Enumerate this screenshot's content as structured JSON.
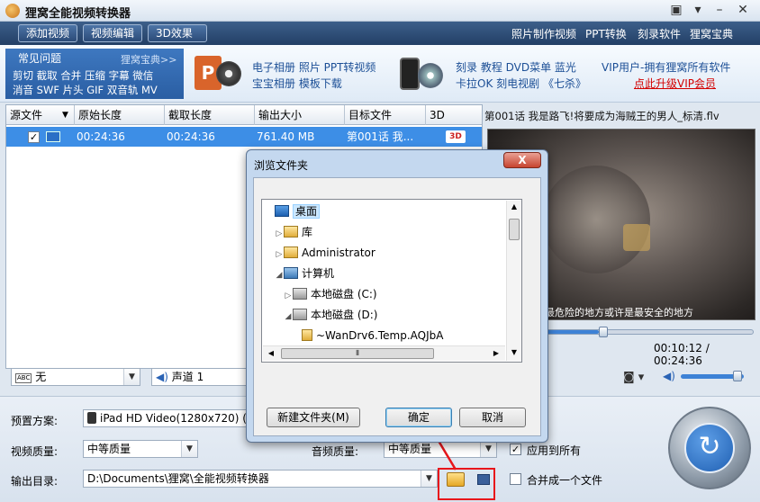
{
  "app": {
    "title": "狸窝全能视频转换器"
  },
  "toolbar": {
    "buttons": [
      "添加视频",
      "视频编辑",
      "3D效果"
    ],
    "links": [
      "照片制作视频",
      "PPT转换",
      "刻录软件",
      "狸窝宝典"
    ]
  },
  "banner": {
    "faq_title": "常见问题",
    "faq_more": "狸窝宝典>>",
    "faq_row1": "剪切 截取 合并 压缩 字幕 微信",
    "faq_row2": "消音 SWF 片头 GIF 双音轨 MV",
    "promo1_row1": "电子相册 照片 PPT转视频",
    "promo1_row2": "宝宝相册 模板下载",
    "promo2_row1": "刻录 教程 DVD菜单 蓝光",
    "promo2_row2": "卡拉OK 刻电视剧 《七杀》",
    "vip_text": "VIP用户-拥有狸窝所有软件",
    "vip_link": "点此升级VIP会员"
  },
  "table": {
    "headers": [
      "源文件",
      "原始长度",
      "截取长度",
      "输出大小",
      "目标文件",
      "3D"
    ],
    "rows": [
      {
        "checked": true,
        "original": "00:24:36",
        "clip": "00:24:36",
        "size": "761.40 MB",
        "target": "第001话 我...",
        "badge": "3D"
      }
    ]
  },
  "preview": {
    "title": "第001话 我是路飞!将要成为海贼王的男人_标清.flv",
    "subtitle": "最危险的地方或许是最安全的地方",
    "time": "00:10:12 / 00:24:36",
    "progress": 0.415
  },
  "audio_controls": {
    "subtitle_value": "无",
    "subtitle_tag": "ABC",
    "audio_track": "声道 1"
  },
  "settings": {
    "preset_label": "预置方案:",
    "preset_value": "iPad HD Video(1280x720) (*.",
    "video_quality_label": "视频质量:",
    "video_quality_value": "中等质量",
    "audio_quality_label": "音频质量:",
    "audio_quality_value": "中等质量",
    "apply_all_label": "应用到所有",
    "apply_all_checked": true,
    "output_dir_label": "输出目录:",
    "output_dir_value": "D:\\Documents\\狸窝\\全能视频转换器",
    "merge_label": "合并成一个文件",
    "merge_checked": false
  },
  "dialog": {
    "title": "浏览文件夹",
    "close": "X",
    "tree": [
      {
        "label": "桌面",
        "level": 0,
        "expander": "",
        "icon": "desktop-icon",
        "selected": true
      },
      {
        "label": "库",
        "level": 1,
        "expander": "▷",
        "icon": "library-icon"
      },
      {
        "label": "Administrator",
        "level": 1,
        "expander": "▷",
        "icon": "user-folder-icon"
      },
      {
        "label": "计算机",
        "level": 1,
        "expander": "◢",
        "icon": "computer-icon"
      },
      {
        "label": "本地磁盘 (C:)",
        "level": 2,
        "expander": "▷",
        "icon": "drive-c-icon"
      },
      {
        "label": "本地磁盘 (D:)",
        "level": 2,
        "expander": "◢",
        "icon": "drive-d-icon"
      },
      {
        "label": "~WanDrv6.Temp.AQJbA",
        "level": 3,
        "expander": "",
        "icon": "folder-icon"
      }
    ],
    "new_folder": "新建文件夹(M)",
    "ok": "确定",
    "cancel": "取消"
  },
  "colors": {
    "accent": "#3d8ee6",
    "annotation": "#e8161b",
    "toolbar": "#233f66"
  }
}
